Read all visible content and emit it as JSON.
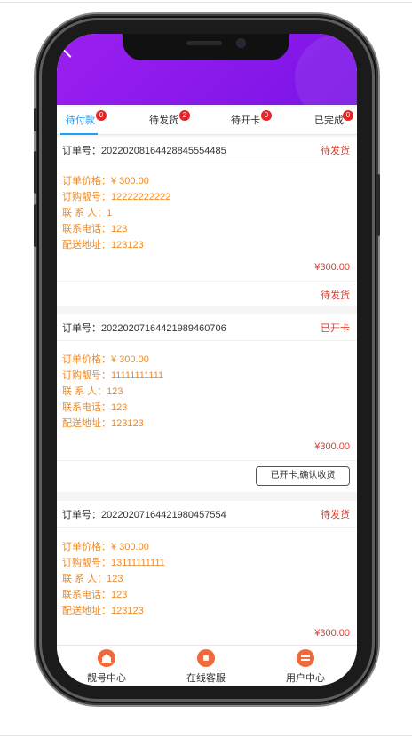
{
  "tabs": [
    {
      "label": "待付款",
      "badge": "0"
    },
    {
      "label": "待发货",
      "badge": "2"
    },
    {
      "label": "待开卡",
      "badge": "0"
    },
    {
      "label": "已完成",
      "badge": "0"
    }
  ],
  "orders": [
    {
      "order_no": "订单号：20220208164428845554485",
      "status": "待发货",
      "price": "订单价格：¥ 300.00",
      "number": "订购靓号：12222222222",
      "contact": "联 系 人：1",
      "phone": "联系电话：123",
      "address": "配送地址：123123",
      "total": "¥300.00",
      "footer_status": "待发货"
    },
    {
      "order_no": "订单号：20220207164421989460706",
      "status": "已开卡",
      "price": "订单价格：¥ 300.00",
      "number": "订购靓号：11111111111",
      "contact": "联 系 人：123",
      "phone": "联系电话：123",
      "address": "配送地址：123123",
      "total": "¥300.00",
      "action_label": "已开卡,确认收货"
    },
    {
      "order_no": "订单号：20220207164421980457554",
      "status": "待发货",
      "price": "订单价格：¥ 300.00",
      "number": "订购靓号：13111111111",
      "contact": "联 系 人：123",
      "phone": "联系电话：123",
      "address": "配送地址：123123",
      "total": "¥300.00"
    }
  ],
  "tabbar": [
    {
      "label": "靓号中心",
      "icon": "home-icon"
    },
    {
      "label": "在线客服",
      "icon": "compass-icon"
    },
    {
      "label": "用户中心",
      "icon": "chat-icon"
    }
  ],
  "colors": {
    "header_gradient_start": "#9b1ff0",
    "header_gradient_end": "#7a14e6",
    "active_tab": "#1aa0ff",
    "status_red": "#e33a2a",
    "detail_orange": "#f08a24",
    "icon_orange": "#f0693a"
  }
}
